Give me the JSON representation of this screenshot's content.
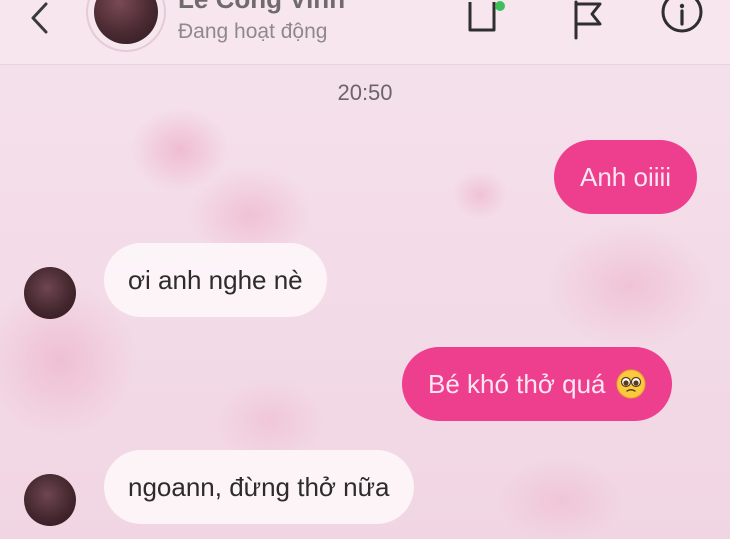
{
  "header": {
    "contact_name": "Lê Công Vinh",
    "status": "Đang hoạt động",
    "icons": [
      "back-chevron-icon",
      "video-call-icon",
      "flag-icon",
      "info-icon"
    ]
  },
  "conversation": {
    "timestamp": "20:50",
    "messages": [
      {
        "direction": "outgoing",
        "text": "Anh oiiii"
      },
      {
        "direction": "incoming",
        "text": "ơi anh nghe nè"
      },
      {
        "direction": "outgoing",
        "text": "Bé khó thở quá",
        "emoji": "pleading-face-emoji"
      },
      {
        "direction": "incoming",
        "text": "ngoann, đừng thở nữa"
      }
    ]
  },
  "colors": {
    "outgoing_bubble": "#ee3e8e",
    "incoming_bubble": "#fdf6f9",
    "background": "#f3d9e6",
    "online_dot": "#3fbf5a"
  }
}
